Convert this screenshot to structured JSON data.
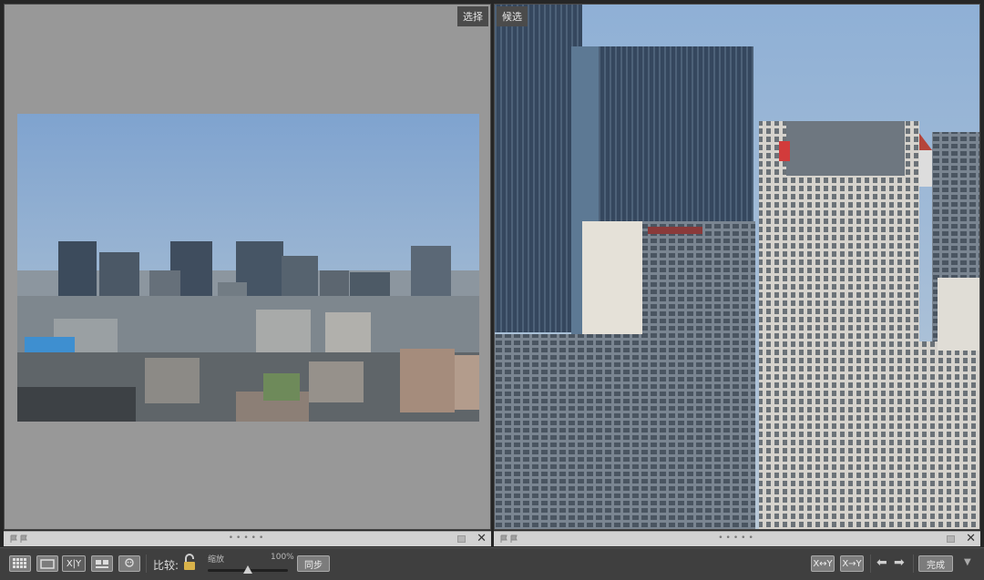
{
  "panes": {
    "left_label": "选择",
    "right_label": "候选"
  },
  "toolbar": {
    "compare_label": "比较:",
    "zoom_label": "缩放",
    "zoom_value": "100%",
    "sync_label": "同步",
    "done_label": "完成",
    "xy_label": "X|Y",
    "xy_swap_left": "X↔Y",
    "xy_swap_right": "X→Y"
  },
  "icons": {
    "grid": "grid-view-icon",
    "loupe": "loupe-view-icon",
    "compare": "compare-view-icon",
    "survey": "survey-view-icon",
    "people": "people-view-icon",
    "lock": "lock-icon",
    "prev": "arrow-left-icon",
    "next": "arrow-right-icon",
    "menu": "chevron-down-icon"
  },
  "colors": {
    "pane_bg": "#989898",
    "toolbar_bg": "#3f3f3f",
    "lock": "#d8b24a"
  }
}
